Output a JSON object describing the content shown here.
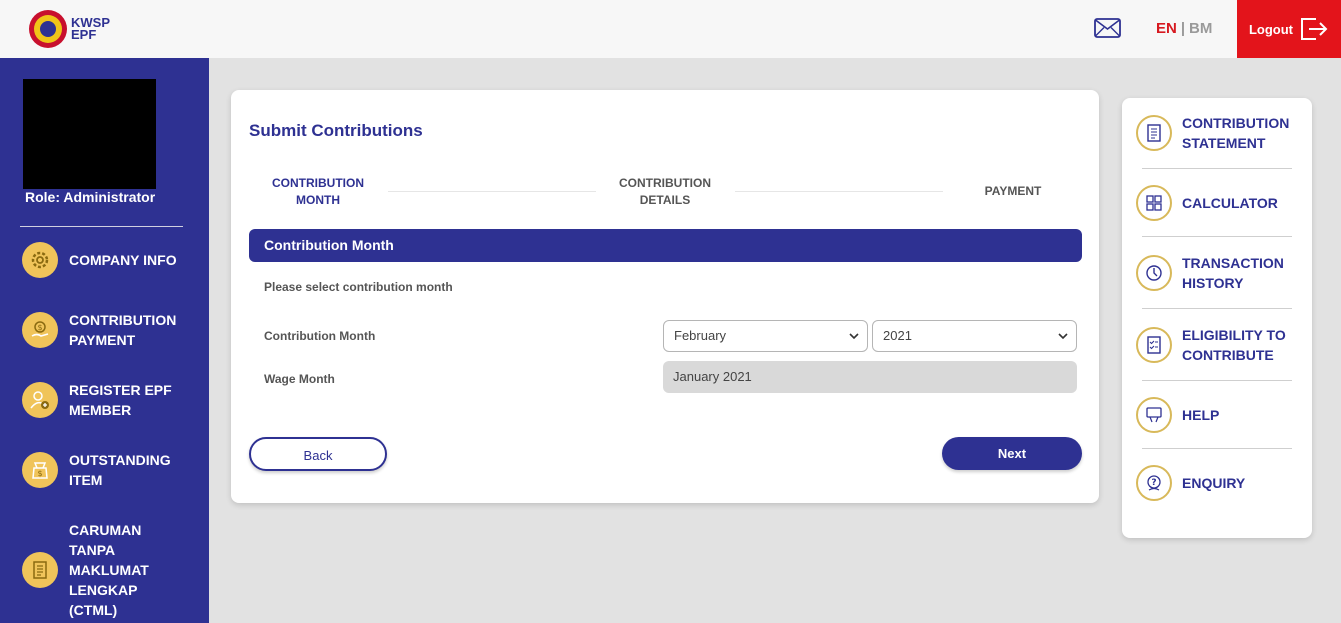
{
  "header": {
    "logo_line1": "KWSP",
    "logo_line2": "EPF",
    "mail_icon": "envelope-icon",
    "lang_en": "EN",
    "lang_separator": "|",
    "lang_bm": "BM",
    "logout_label": "Logout",
    "logout_icon": "logout-icon"
  },
  "sidebar": {
    "role": "Role: Administrator",
    "items": [
      {
        "label": "COMPANY INFO",
        "icon": "gear-icon"
      },
      {
        "label": "CONTRIBUTION PAYMENT",
        "icon": "money-hand-icon"
      },
      {
        "label": "REGISTER EPF MEMBER",
        "icon": "add-user-icon"
      },
      {
        "label": "OUTSTANDING ITEM",
        "icon": "money-bag-icon"
      },
      {
        "label": "CARUMAN TANPA MAKLUMAT LENGKAP (CTML)",
        "icon": "document-icon"
      }
    ]
  },
  "main": {
    "title": "Submit Contributions",
    "steps": [
      {
        "label": "CONTRIBUTION MONTH",
        "active": true
      },
      {
        "label": "CONTRIBUTION DETAILS",
        "active": false
      },
      {
        "label": "PAYMENT",
        "active": false
      }
    ],
    "section_title": "Contribution Month",
    "instruction": "Please select contribution month",
    "contribution_month_label": "Contribution Month",
    "month_value": "February",
    "year_value": "2021",
    "wage_month_label": "Wage Month",
    "wage_month_value": "January 2021",
    "back_label": "Back",
    "next_label": "Next"
  },
  "quick_links": [
    {
      "label": "CONTRIBUTION STATEMENT",
      "icon": "statement-icon"
    },
    {
      "label": "CALCULATOR",
      "icon": "calculator-icon"
    },
    {
      "label": "TRANSACTION HISTORY",
      "icon": "history-icon"
    },
    {
      "label": "ELIGIBILITY TO CONTRIBUTE",
      "icon": "checklist-icon"
    },
    {
      "label": "HELP",
      "icon": "help-icon"
    },
    {
      "label": "ENQUIRY",
      "icon": "enquiry-icon"
    }
  ],
  "colors": {
    "primary": "#2e3192",
    "logout_red": "#e3141b",
    "lang_active": "#d71920",
    "icon_gold": "#f0c45a"
  }
}
